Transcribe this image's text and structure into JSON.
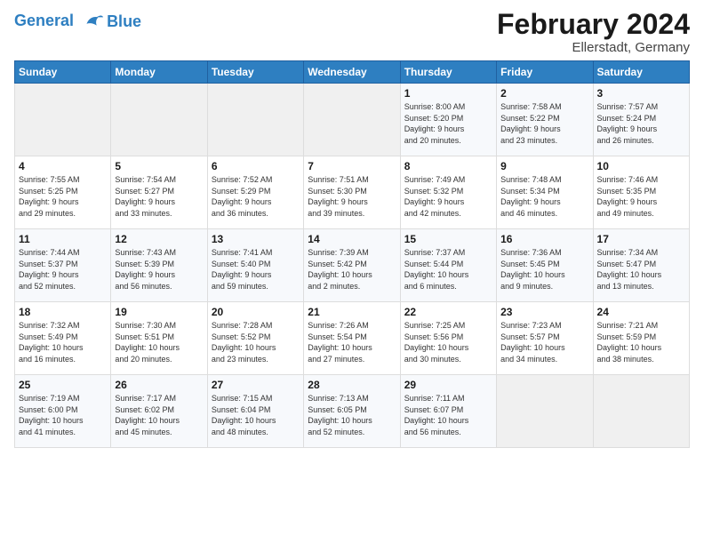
{
  "logo": {
    "line1": "General",
    "line2": "Blue"
  },
  "title": "February 2024",
  "subtitle": "Ellerstadt, Germany",
  "headers": [
    "Sunday",
    "Monday",
    "Tuesday",
    "Wednesday",
    "Thursday",
    "Friday",
    "Saturday"
  ],
  "weeks": [
    {
      "days": [
        {
          "num": "",
          "detail": ""
        },
        {
          "num": "",
          "detail": ""
        },
        {
          "num": "",
          "detail": ""
        },
        {
          "num": "",
          "detail": ""
        },
        {
          "num": "1",
          "detail": "Sunrise: 8:00 AM\nSunset: 5:20 PM\nDaylight: 9 hours\nand 20 minutes."
        },
        {
          "num": "2",
          "detail": "Sunrise: 7:58 AM\nSunset: 5:22 PM\nDaylight: 9 hours\nand 23 minutes."
        },
        {
          "num": "3",
          "detail": "Sunrise: 7:57 AM\nSunset: 5:24 PM\nDaylight: 9 hours\nand 26 minutes."
        }
      ]
    },
    {
      "days": [
        {
          "num": "4",
          "detail": "Sunrise: 7:55 AM\nSunset: 5:25 PM\nDaylight: 9 hours\nand 29 minutes."
        },
        {
          "num": "5",
          "detail": "Sunrise: 7:54 AM\nSunset: 5:27 PM\nDaylight: 9 hours\nand 33 minutes."
        },
        {
          "num": "6",
          "detail": "Sunrise: 7:52 AM\nSunset: 5:29 PM\nDaylight: 9 hours\nand 36 minutes."
        },
        {
          "num": "7",
          "detail": "Sunrise: 7:51 AM\nSunset: 5:30 PM\nDaylight: 9 hours\nand 39 minutes."
        },
        {
          "num": "8",
          "detail": "Sunrise: 7:49 AM\nSunset: 5:32 PM\nDaylight: 9 hours\nand 42 minutes."
        },
        {
          "num": "9",
          "detail": "Sunrise: 7:48 AM\nSunset: 5:34 PM\nDaylight: 9 hours\nand 46 minutes."
        },
        {
          "num": "10",
          "detail": "Sunrise: 7:46 AM\nSunset: 5:35 PM\nDaylight: 9 hours\nand 49 minutes."
        }
      ]
    },
    {
      "days": [
        {
          "num": "11",
          "detail": "Sunrise: 7:44 AM\nSunset: 5:37 PM\nDaylight: 9 hours\nand 52 minutes."
        },
        {
          "num": "12",
          "detail": "Sunrise: 7:43 AM\nSunset: 5:39 PM\nDaylight: 9 hours\nand 56 minutes."
        },
        {
          "num": "13",
          "detail": "Sunrise: 7:41 AM\nSunset: 5:40 PM\nDaylight: 9 hours\nand 59 minutes."
        },
        {
          "num": "14",
          "detail": "Sunrise: 7:39 AM\nSunset: 5:42 PM\nDaylight: 10 hours\nand 2 minutes."
        },
        {
          "num": "15",
          "detail": "Sunrise: 7:37 AM\nSunset: 5:44 PM\nDaylight: 10 hours\nand 6 minutes."
        },
        {
          "num": "16",
          "detail": "Sunrise: 7:36 AM\nSunset: 5:45 PM\nDaylight: 10 hours\nand 9 minutes."
        },
        {
          "num": "17",
          "detail": "Sunrise: 7:34 AM\nSunset: 5:47 PM\nDaylight: 10 hours\nand 13 minutes."
        }
      ]
    },
    {
      "days": [
        {
          "num": "18",
          "detail": "Sunrise: 7:32 AM\nSunset: 5:49 PM\nDaylight: 10 hours\nand 16 minutes."
        },
        {
          "num": "19",
          "detail": "Sunrise: 7:30 AM\nSunset: 5:51 PM\nDaylight: 10 hours\nand 20 minutes."
        },
        {
          "num": "20",
          "detail": "Sunrise: 7:28 AM\nSunset: 5:52 PM\nDaylight: 10 hours\nand 23 minutes."
        },
        {
          "num": "21",
          "detail": "Sunrise: 7:26 AM\nSunset: 5:54 PM\nDaylight: 10 hours\nand 27 minutes."
        },
        {
          "num": "22",
          "detail": "Sunrise: 7:25 AM\nSunset: 5:56 PM\nDaylight: 10 hours\nand 30 minutes."
        },
        {
          "num": "23",
          "detail": "Sunrise: 7:23 AM\nSunset: 5:57 PM\nDaylight: 10 hours\nand 34 minutes."
        },
        {
          "num": "24",
          "detail": "Sunrise: 7:21 AM\nSunset: 5:59 PM\nDaylight: 10 hours\nand 38 minutes."
        }
      ]
    },
    {
      "days": [
        {
          "num": "25",
          "detail": "Sunrise: 7:19 AM\nSunset: 6:00 PM\nDaylight: 10 hours\nand 41 minutes."
        },
        {
          "num": "26",
          "detail": "Sunrise: 7:17 AM\nSunset: 6:02 PM\nDaylight: 10 hours\nand 45 minutes."
        },
        {
          "num": "27",
          "detail": "Sunrise: 7:15 AM\nSunset: 6:04 PM\nDaylight: 10 hours\nand 48 minutes."
        },
        {
          "num": "28",
          "detail": "Sunrise: 7:13 AM\nSunset: 6:05 PM\nDaylight: 10 hours\nand 52 minutes."
        },
        {
          "num": "29",
          "detail": "Sunrise: 7:11 AM\nSunset: 6:07 PM\nDaylight: 10 hours\nand 56 minutes."
        },
        {
          "num": "",
          "detail": ""
        },
        {
          "num": "",
          "detail": ""
        }
      ]
    }
  ]
}
